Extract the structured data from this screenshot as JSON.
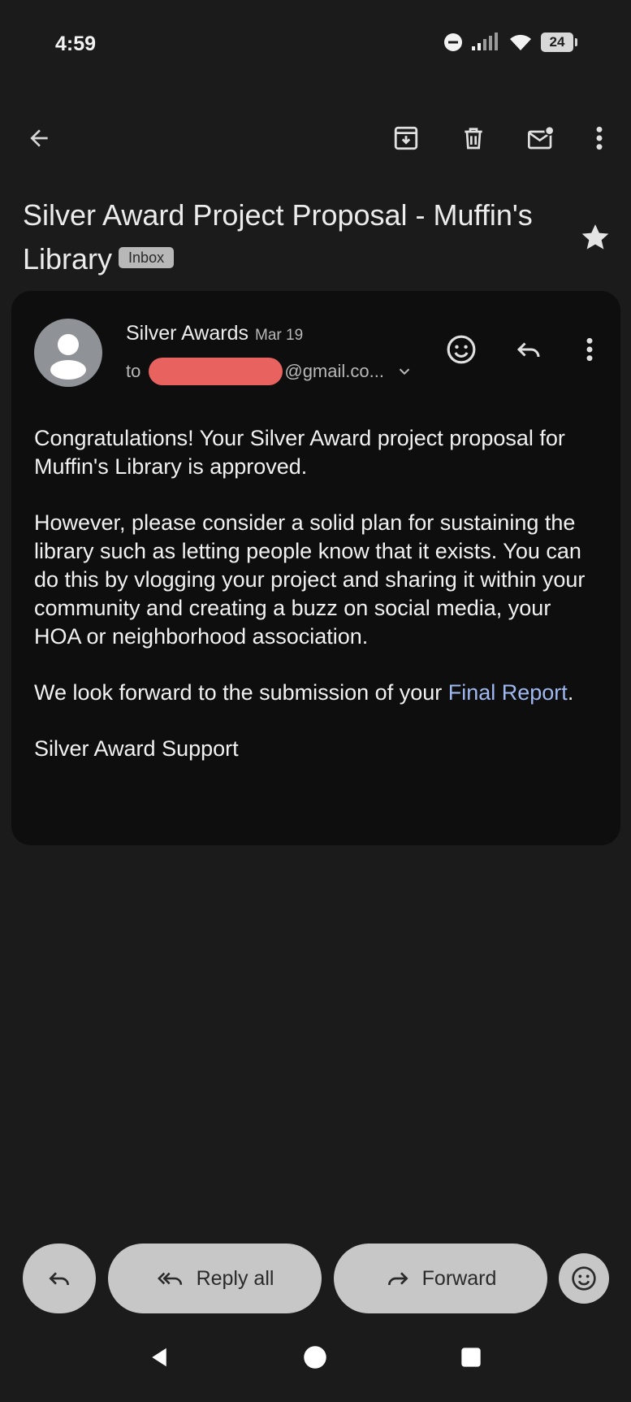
{
  "status_bar": {
    "time": "4:59",
    "battery": "24"
  },
  "toolbar": {
    "icons": [
      "back-arrow-icon",
      "archive-icon",
      "delete-icon",
      "mark-unread-icon",
      "more-vert-icon"
    ]
  },
  "email": {
    "subject": "Silver Award Project Proposal - Muffin's Library",
    "label": "Inbox",
    "sender": "Silver Awards",
    "date": "Mar 19",
    "to_prefix": "to",
    "to_suffix": "@gmail.co...",
    "body": {
      "p1": "Congratulations! Your Silver Award project proposal for Muffin's Library is approved.",
      "p2": "However, please consider a solid plan for sustaining the library such as letting people know that it exists. You can do this by vlogging your project and sharing it within your community and creating a buzz on social media, your HOA or neighborhood association.",
      "p3_before": "We look forward to the submission of your ",
      "p3_link": "Final Report",
      "p3_after": ".",
      "signature": "Silver Award Support"
    }
  },
  "actions": {
    "reply_all": "Reply all",
    "forward": "Forward"
  },
  "colors": {
    "background": "#1b1b1b",
    "card": "#0e0e0e",
    "link": "#9fb8ef",
    "pill": "#c7c7c7",
    "redaction": "#e8625f"
  }
}
